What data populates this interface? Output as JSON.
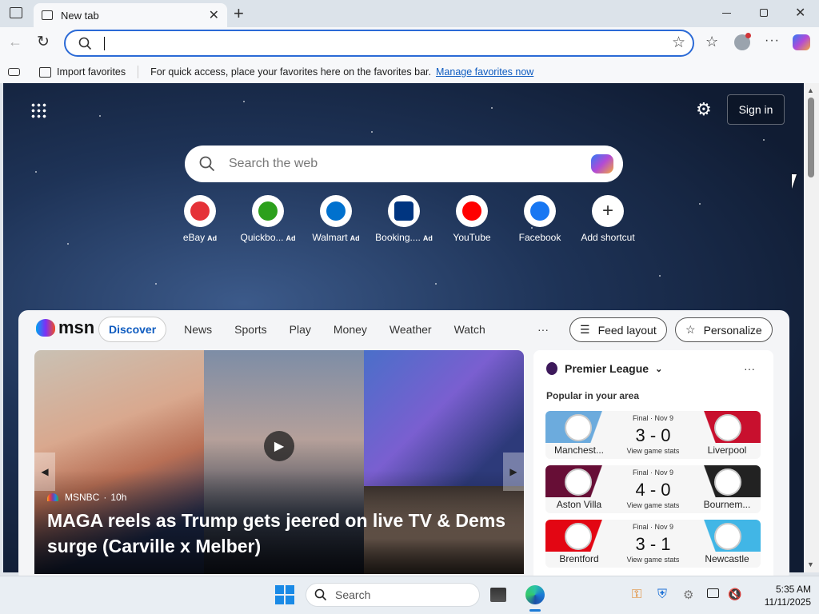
{
  "browser": {
    "tab_title": "New tab",
    "favorites_bar": {
      "import_label": "Import favorites",
      "hint_text": "For quick access, place your favorites here on the favorites bar.",
      "manage_link": "Manage favorites now"
    }
  },
  "newtab": {
    "sign_in": "Sign in",
    "search_placeholder": "Search the web",
    "shortcuts": [
      {
        "label": "eBay",
        "ad": "Ad",
        "color": "#e53238"
      },
      {
        "label": "Quickbo...",
        "ad": "Ad",
        "color": "#2ca01c"
      },
      {
        "label": "Walmart",
        "ad": "Ad",
        "color": "#0071ce"
      },
      {
        "label": "Booking....",
        "ad": "Ad",
        "color": "#003580"
      },
      {
        "label": "YouTube",
        "ad": "",
        "color": "#ff0000"
      },
      {
        "label": "Facebook",
        "ad": "",
        "color": "#1877f2"
      },
      {
        "label": "Add shortcut",
        "ad": "",
        "color": "#333333"
      }
    ]
  },
  "feed": {
    "brand": "msn",
    "nav": [
      "Discover",
      "News",
      "Sports",
      "Play",
      "Money",
      "Weather",
      "Watch"
    ],
    "more": "···",
    "feed_layout": "Feed layout",
    "personalize": "Personalize",
    "hero": {
      "source": "MSNBC",
      "age": "10h",
      "headline_line1": "MAGA reels as Trump gets jeered on live TV & Dems",
      "headline_line2": "surge (Carville x Melber)"
    },
    "league": {
      "title": "Premier League",
      "subtitle": "Popular in your area",
      "matches": [
        {
          "status": "Final · Nov 9",
          "score": "3 - 0",
          "home": "Manchest...",
          "away": "Liverpool",
          "stats": "View game stats",
          "home_color": "#6cabdd",
          "away_color": "#c8102e"
        },
        {
          "status": "Final · Nov 9",
          "score": "4 - 0",
          "home": "Aston Villa",
          "away": "Bournem...",
          "stats": "View game stats",
          "home_color": "#670e36",
          "away_color": "#222222"
        },
        {
          "status": "Final · Nov 9",
          "score": "3 - 1",
          "home": "Brentford",
          "away": "Newcastle",
          "stats": "View game stats",
          "home_color": "#e30613",
          "away_color": "#41b6e6"
        }
      ]
    }
  },
  "taskbar": {
    "search_placeholder": "Search",
    "time": "5:35 AM",
    "date": "11/11/2025"
  }
}
